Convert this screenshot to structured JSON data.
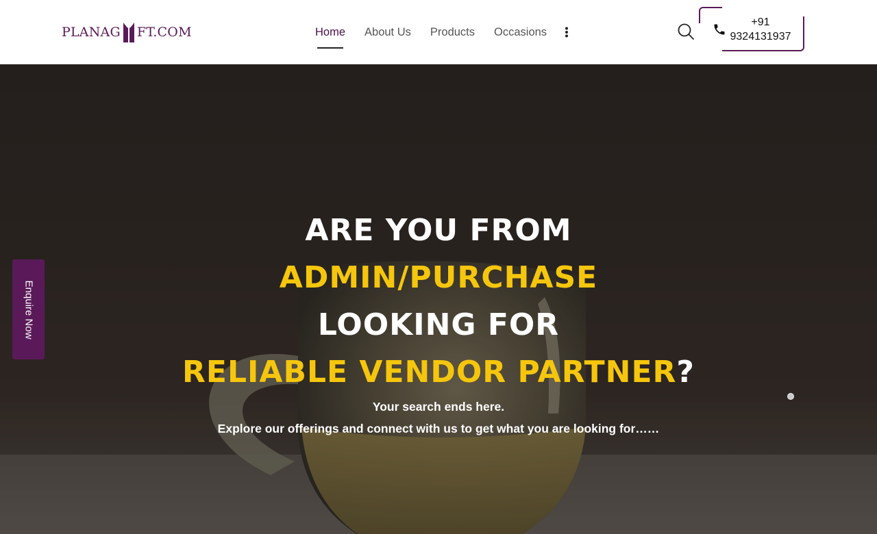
{
  "header": {
    "logo_left": "PLANAG",
    "logo_right": "FT.COM",
    "logo_icon": "gift-icon",
    "nav": [
      {
        "label": "Home",
        "active": true
      },
      {
        "label": "About Us",
        "active": false
      },
      {
        "label": "Products",
        "active": false
      },
      {
        "label": "Occasions",
        "active": false
      }
    ],
    "more_icon": "vertical-dots-icon",
    "search_icon": "search-icon",
    "phone_icon": "phone-icon",
    "phone_line1": "+91",
    "phone_line2": "9324131937"
  },
  "hero": {
    "title_line1": "ARE YOU FROM",
    "title_line2": "ADMIN/PURCHASE",
    "title_line3": "LOOKING FOR",
    "title_line4_highlight": "RELIABLE VENDOR PARTNER",
    "title_line4_suffix": "?",
    "subtitle1": "Your search ends here.",
    "subtitle2": "Explore our offerings and connect with us to get what you are looking for……"
  },
  "enquire_label": "Enquire Now",
  "colors": {
    "brand": "#5a1a59",
    "highlight": "#f5c60c",
    "hero_text": "#ffffff"
  }
}
